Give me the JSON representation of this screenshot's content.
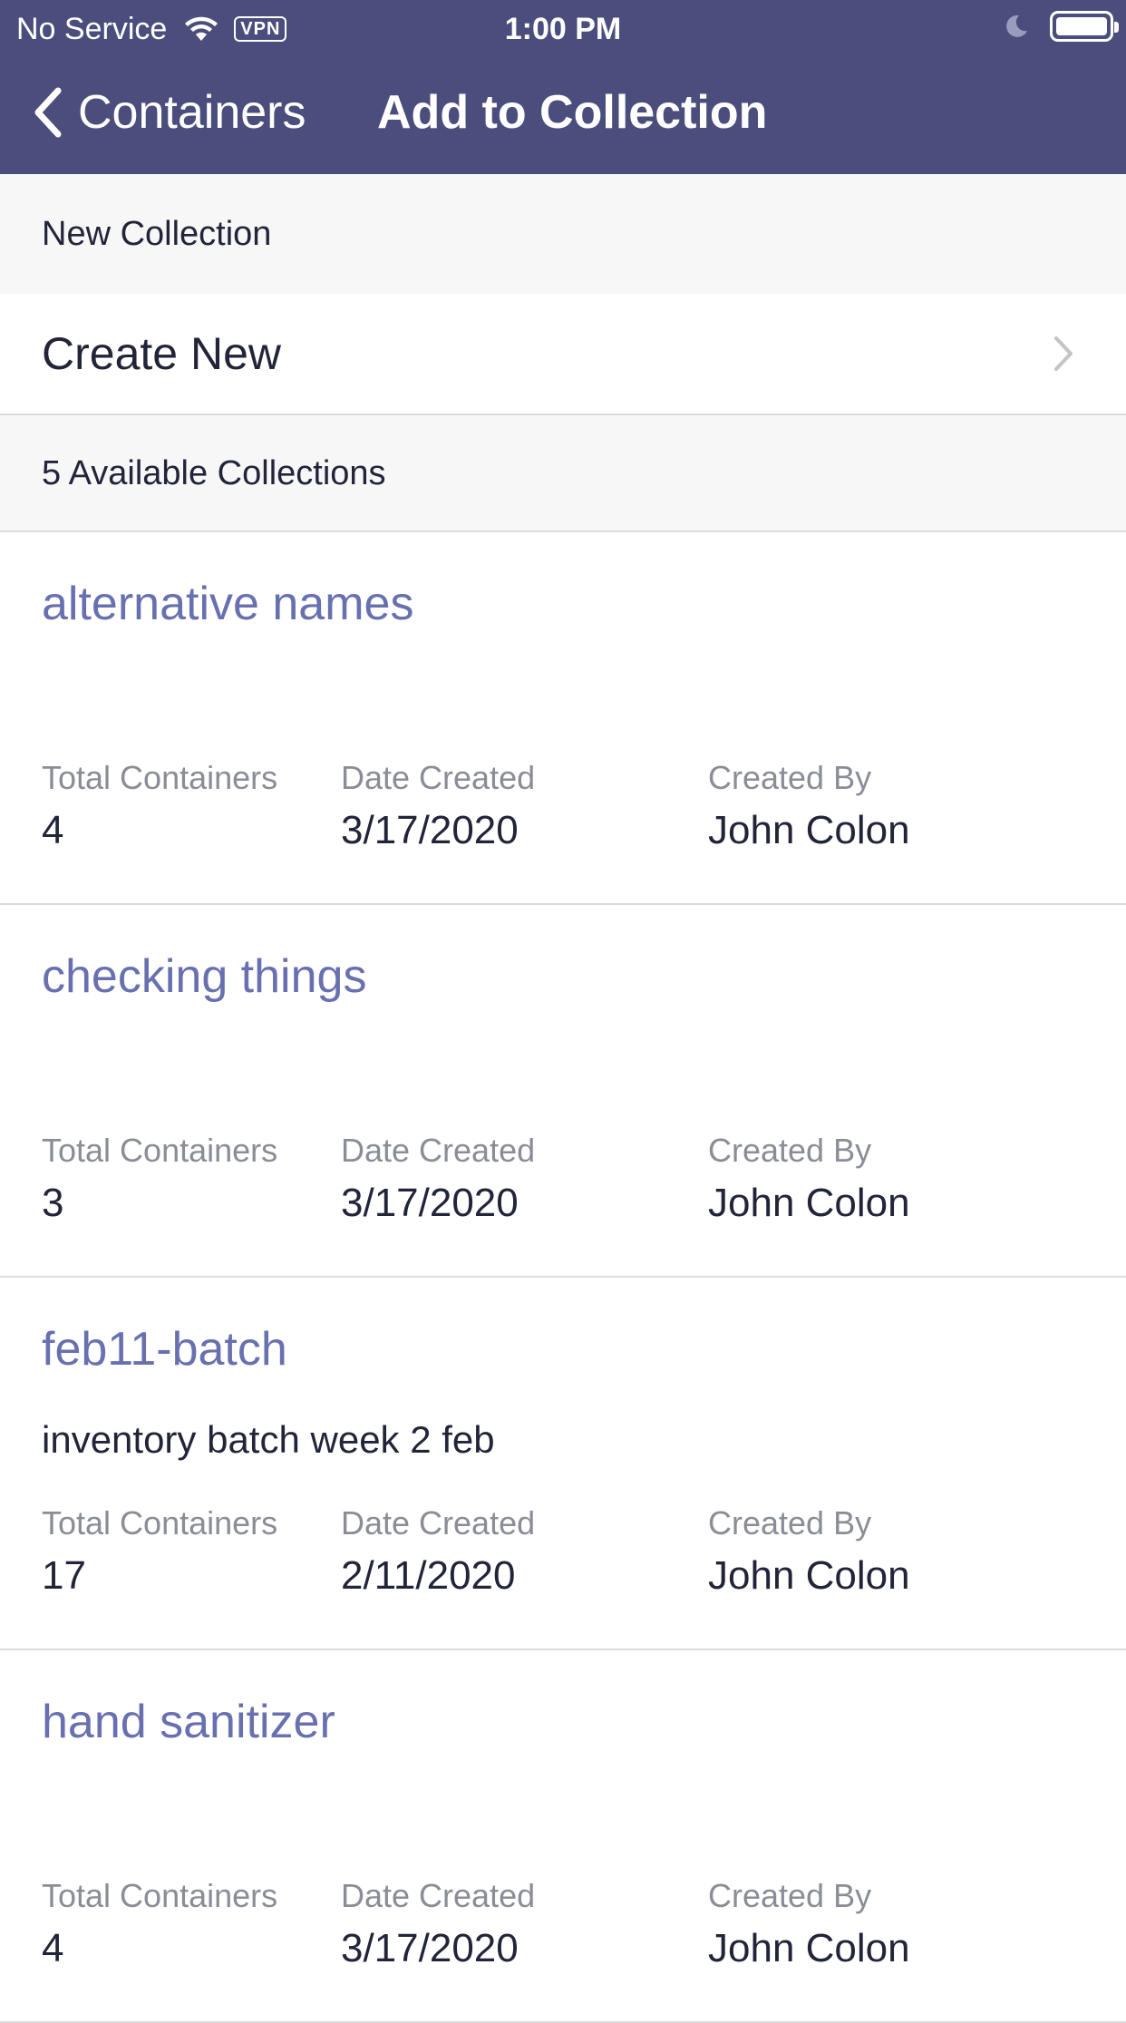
{
  "status_bar": {
    "carrier": "No Service",
    "vpn": "VPN",
    "time": "1:00 PM"
  },
  "nav": {
    "back_label": "Containers",
    "title": "Add to Collection"
  },
  "new_collection": {
    "header": "New Collection",
    "create_label": "Create New"
  },
  "available": {
    "header": "5 Available Collections"
  },
  "field_labels": {
    "total": "Total Containers",
    "date": "Date Created",
    "by": "Created By"
  },
  "collections": [
    {
      "name": "alternative names",
      "description": "",
      "total": "4",
      "date": "3/17/2020",
      "by": "John Colon"
    },
    {
      "name": "checking things",
      "description": "",
      "total": "3",
      "date": "3/17/2020",
      "by": "John Colon"
    },
    {
      "name": "feb11-batch",
      "description": "inventory batch week 2 feb",
      "total": "17",
      "date": "2/11/2020",
      "by": "John Colon"
    },
    {
      "name": "hand sanitizer",
      "description": "",
      "total": "4",
      "date": "3/17/2020",
      "by": "John Colon"
    }
  ],
  "colors": {
    "nav_background": "#4b4e7d",
    "link": "#6870b0",
    "section_background": "#f7f7f7"
  },
  "icons": [
    "wifi-icon",
    "moon-icon",
    "battery-icon",
    "chevron-left-icon",
    "chevron-right-icon"
  ]
}
